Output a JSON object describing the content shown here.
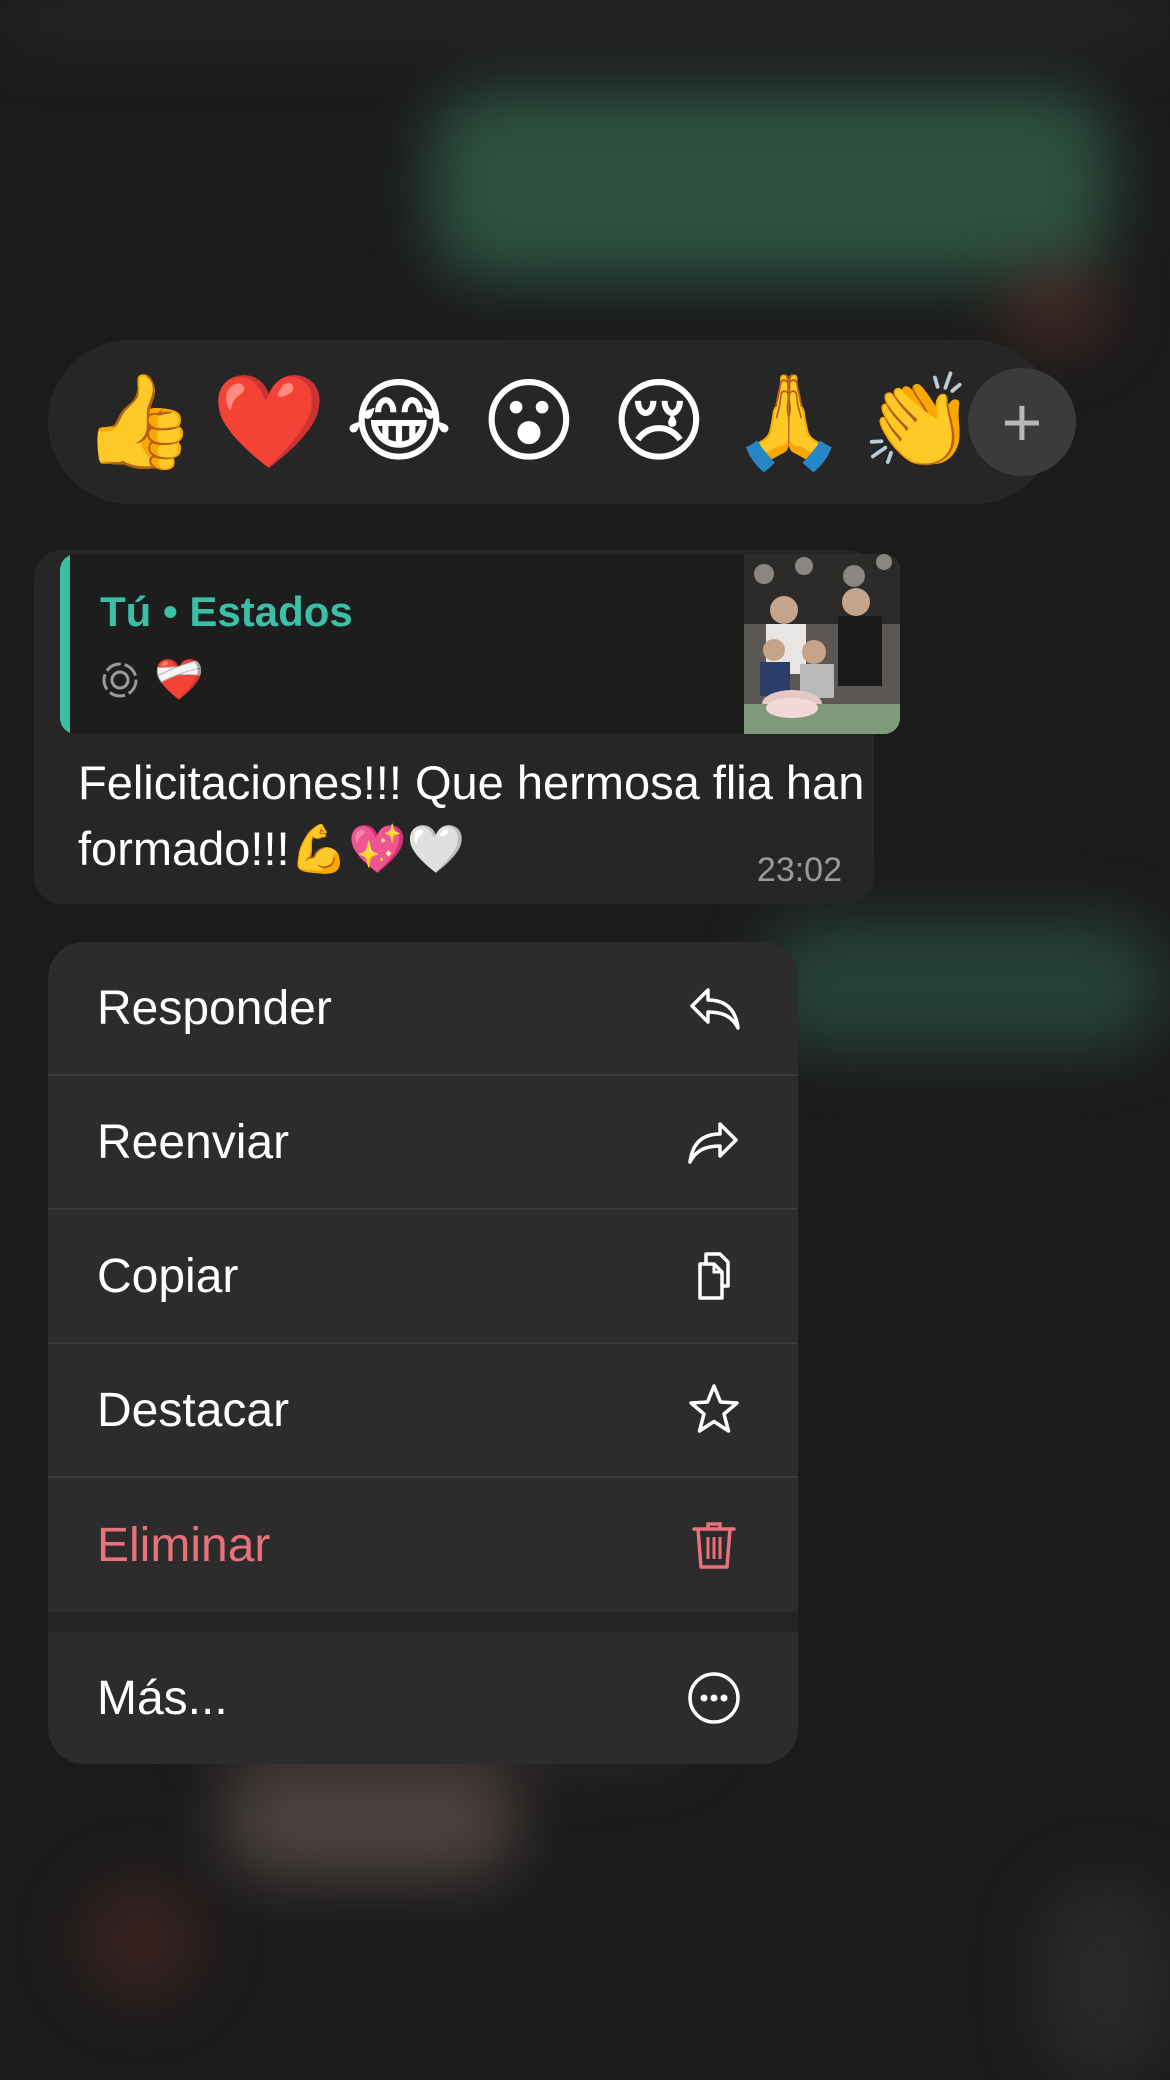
{
  "reactions": {
    "emojis": [
      "👍",
      "❤️",
      "😂",
      "😮",
      "😢",
      "🙏",
      "👏"
    ],
    "more_label": "+"
  },
  "message": {
    "quote_title": "Tú • Estados",
    "quote_sub_emoji": "❤️‍🩹",
    "text": "Felicitaciones!!! Que hermosa flia han formado!!!💪💖🤍",
    "time": "23:02"
  },
  "menu": {
    "items": [
      {
        "label": "Responder",
        "icon": "reply-icon"
      },
      {
        "label": "Reenviar",
        "icon": "forward-icon"
      },
      {
        "label": "Copiar",
        "icon": "copy-icon"
      },
      {
        "label": "Destacar",
        "icon": "star-icon"
      },
      {
        "label": "Eliminar",
        "icon": "trash-icon"
      }
    ],
    "more": {
      "label": "Más...",
      "icon": "more-icon"
    }
  },
  "colors": {
    "accent": "#3bbfa6",
    "danger": "#e9727a",
    "background": "#1b1b1b"
  }
}
